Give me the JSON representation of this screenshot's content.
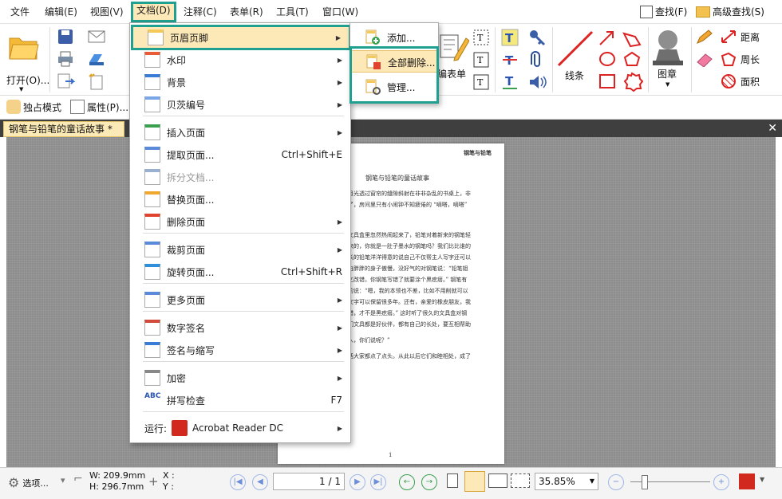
{
  "menubar": {
    "items": [
      "文件",
      "编辑(E)",
      "视图(V)",
      "文档(D)",
      "注释(C)",
      "表单(R)",
      "工具(T)",
      "窗口(W)"
    ],
    "search_label": "查找(F)",
    "advanced_search_label": "高级查找(S)"
  },
  "ribbon": {
    "open_label": "打开(O)...",
    "form_label": "编表单",
    "lines_label": "线条",
    "stamp_label": "图章",
    "distance_label": "距离",
    "perimeter_label": "周长",
    "area_label": "面积"
  },
  "quick_access": {
    "exclusive_mode_label": "独占模式",
    "properties_label": "属性(P)..."
  },
  "document_tab": {
    "title": "钢笔与铅笔的童话故事 *"
  },
  "doc_menu": {
    "items": [
      {
        "label": "页眉页脚",
        "shortcut": "",
        "submenu": true
      },
      {
        "label": "水印",
        "shortcut": "",
        "submenu": true
      },
      {
        "label": "背景",
        "shortcut": "",
        "submenu": true
      },
      {
        "label": "贝茨编号",
        "shortcut": "",
        "submenu": true
      },
      {
        "label": "插入页面",
        "shortcut": "",
        "submenu": true
      },
      {
        "label": "提取页面...",
        "shortcut": "Ctrl+Shift+E",
        "submenu": false
      },
      {
        "label": "拆分文档...",
        "shortcut": "",
        "submenu": false
      },
      {
        "label": "替换页面...",
        "shortcut": "",
        "submenu": false
      },
      {
        "label": "删除页面",
        "shortcut": "",
        "submenu": true
      },
      {
        "label": "裁剪页面",
        "shortcut": "",
        "submenu": true
      },
      {
        "label": "旋转页面...",
        "shortcut": "Ctrl+Shift+R",
        "submenu": false
      },
      {
        "label": "更多页面",
        "shortcut": "",
        "submenu": true
      },
      {
        "label": "数字签名",
        "shortcut": "",
        "submenu": true
      },
      {
        "label": "签名与缩写",
        "shortcut": "",
        "submenu": true
      },
      {
        "label": "加密",
        "shortcut": "",
        "submenu": true
      },
      {
        "label": "拼写检查",
        "shortcut": "F7",
        "submenu": false
      },
      {
        "label": "运行:",
        "shortcut": "",
        "submenu": true
      }
    ],
    "run_app": "Acrobat Reader DC",
    "abc_badge": "ABC"
  },
  "sub_menu": {
    "items": [
      "添加...",
      "全部删除...",
      "管理..."
    ]
  },
  "page": {
    "header_right": "钢笔与铅笔",
    "title": "钢笔与铅笔的童话故事",
    "lines": [
      "月光透过窗帘的缝隙斜射在非非杂乱的书桌上，非",
      "了，房间里只有小闹钟不知疲倦的 “嘀嗒，嘀嗒”",
      "文具盒里忽然热闹起来了，铅笔对着新来的钢笔轻",
      "来的，你就是一肚子墨水的钢笔吗？我们比比谁的",
      "长的铅笔洋洋得意的说自己不仅帮主人写字还可以",
      "白胖胖的身子傲慢，没好气的对钢笔说：“铅笔姐",
      "乞改错，你钢笔写错了就要涂个黑疙瘩。” 钢笔有",
      "的说：“嗯，我的本领也不差，比如不用削就可以",
      "文字可以保留很多年。还有，亲爱的橡皮朋友，我",
      "错，才不是黑疙瘩。” 这时听了很久的文具盒对钢",
      "们文具都是好伙伴，都有自己的长处，要互相帮助",
      "人，你们说呢？”",
      "话大家都点了点头。从此以后它们和睦相处，成了"
    ],
    "page_number": "1"
  },
  "statusbar": {
    "options_label": "选项...",
    "width_label": "W: 209.9mm",
    "height_label": "H: 296.7mm",
    "x_label": "X :",
    "y_label": "Y :",
    "page_input": "1 / 1",
    "zoom_value": "35.85%"
  }
}
